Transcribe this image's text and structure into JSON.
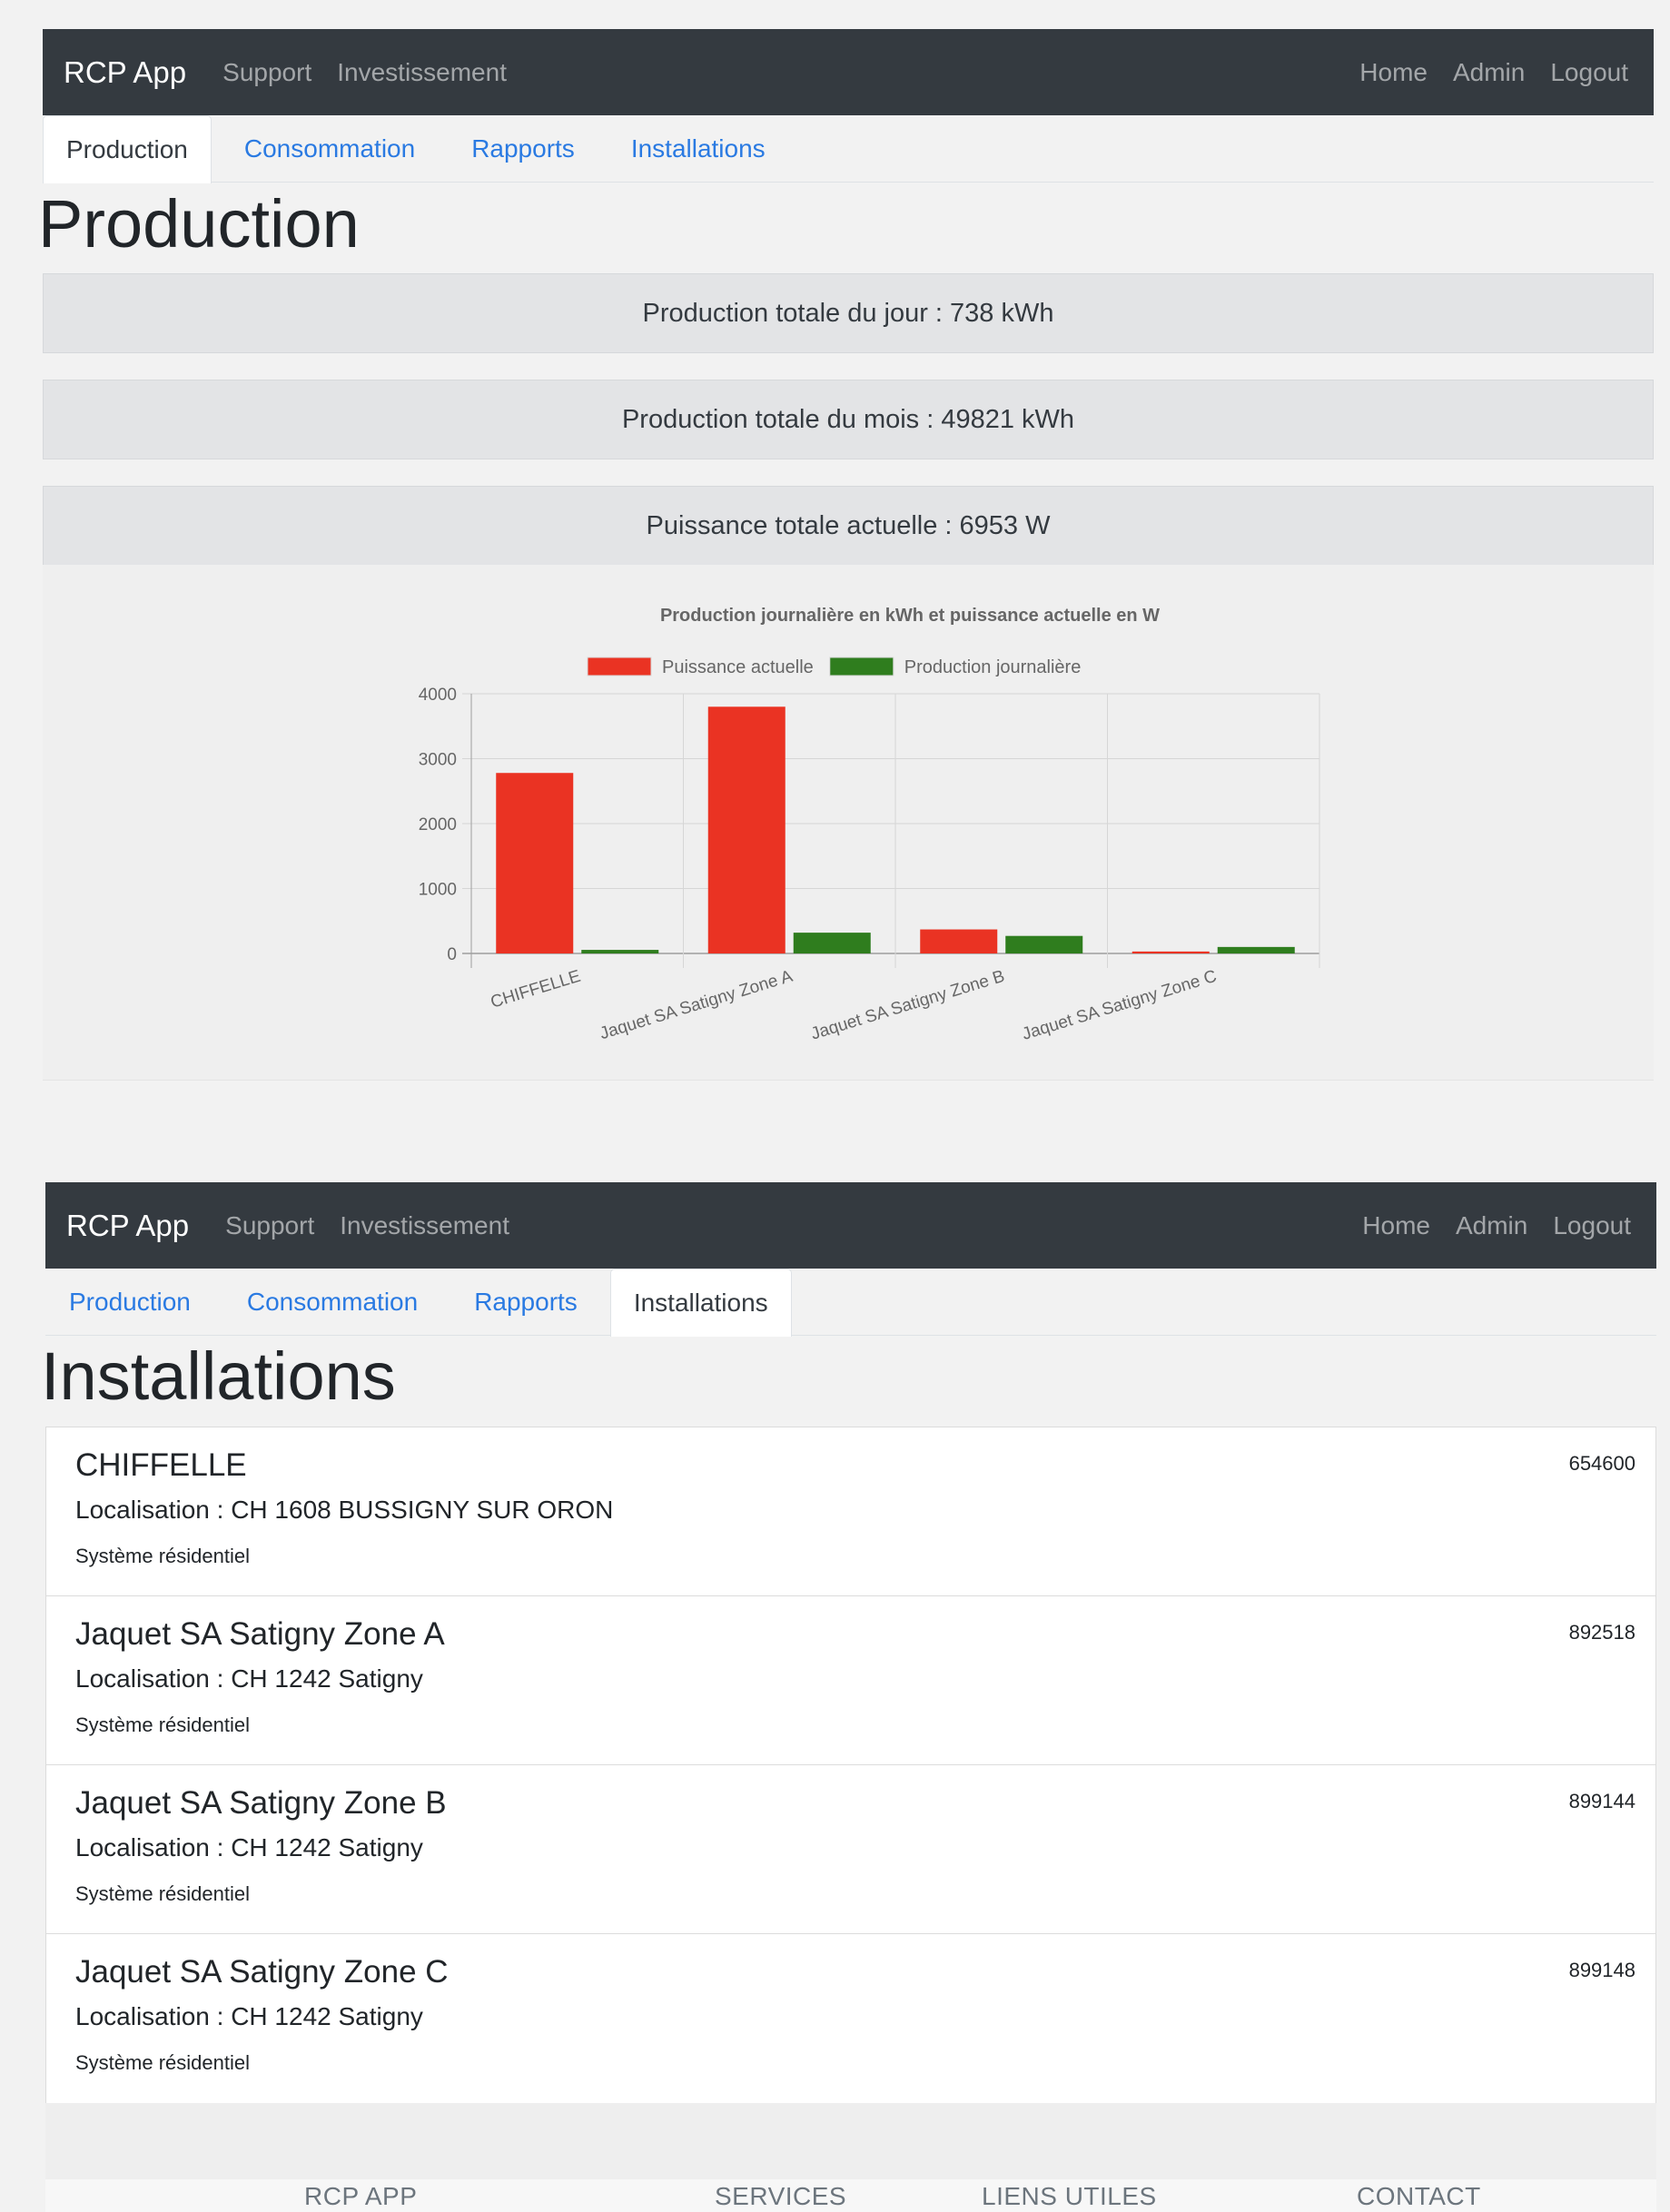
{
  "navbar": {
    "brand": "RCP App",
    "left_links": [
      "Support",
      "Investissement"
    ],
    "right_links": [
      "Home",
      "Admin",
      "Logout"
    ]
  },
  "tabs": [
    "Production",
    "Consommation",
    "Rapports",
    "Installations"
  ],
  "production": {
    "title": "Production",
    "active_tab": "Production",
    "stats": [
      "Production totale du jour : 738 kWh",
      "Production totale du mois : 49821 kWh",
      "Puissance totale actuelle : 6953 W"
    ]
  },
  "chart_data": {
    "type": "bar",
    "title": "Production journalière en kWh et puissance actuelle en W",
    "categories": [
      "CHIFFELLE",
      "Jaquet SA Satigny Zone A",
      "Jaquet SA Satigny Zone B",
      "Jaquet SA Satigny Zone C"
    ],
    "series": [
      {
        "name": "Puissance actuelle",
        "color": "#ea3323",
        "values": [
          2780,
          3800,
          370,
          30
        ]
      },
      {
        "name": "Production journalière",
        "color": "#2f7d1e",
        "values": [
          55,
          320,
          270,
          100
        ]
      }
    ],
    "ylim": [
      0,
      4000
    ],
    "yticks": [
      "4000",
      "3000",
      "2000",
      "1000",
      "0"
    ],
    "legend_position": "top",
    "grid": true
  },
  "installations_page": {
    "title": "Installations",
    "active_tab": "Installations",
    "items": [
      {
        "name": "CHIFFELLE",
        "location": "Localisation : CH 1608 BUSSIGNY SUR ORON",
        "type": "Système résidentiel",
        "id": "654600"
      },
      {
        "name": "Jaquet SA Satigny Zone A",
        "location": "Localisation : CH 1242 Satigny",
        "type": "Système résidentiel",
        "id": "892518"
      },
      {
        "name": "Jaquet SA Satigny Zone B",
        "location": "Localisation : CH 1242 Satigny",
        "type": "Système résidentiel",
        "id": "899144"
      },
      {
        "name": "Jaquet SA Satigny Zone C",
        "location": "Localisation : CH 1242 Satigny",
        "type": "Système résidentiel",
        "id": "899148"
      }
    ]
  },
  "footer": {
    "columns": [
      "RCP APP",
      "SERVICES",
      "LIENS UTILES",
      "CONTACT"
    ]
  }
}
